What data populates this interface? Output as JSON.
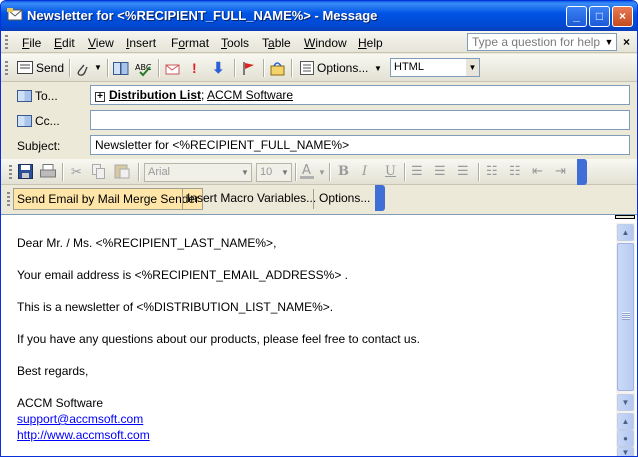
{
  "window": {
    "title": "Newsletter for <%RECIPIENT_FULL_NAME%> - Message",
    "controls": {
      "minimize": "_",
      "maximize": "□",
      "close": "×"
    }
  },
  "menu": {
    "items": [
      {
        "pre": "",
        "u": "F",
        "post": "ile"
      },
      {
        "pre": "",
        "u": "E",
        "post": "dit"
      },
      {
        "pre": "",
        "u": "V",
        "post": "iew"
      },
      {
        "pre": "",
        "u": "I",
        "post": "nsert"
      },
      {
        "pre": "F",
        "u": "o",
        "post": "rmat"
      },
      {
        "pre": "",
        "u": "T",
        "post": "ools"
      },
      {
        "pre": "T",
        "u": "a",
        "post": "ble"
      },
      {
        "pre": "",
        "u": "W",
        "post": "indow"
      },
      {
        "pre": "",
        "u": "H",
        "post": "elp"
      }
    ],
    "ask_placeholder": "Type a question for help",
    "close_glyph": "×"
  },
  "standard_toolbar": {
    "send_label": "Send",
    "options_label": "Options...",
    "format_value": "HTML"
  },
  "header": {
    "to_label": "To...",
    "cc_label": "Cc...",
    "subject_label": "Subject:",
    "to_plus": "+",
    "to_distribution": "Distribution List",
    "to_separator": ";",
    "to_recipient": "ACCM Software",
    "cc_value": "",
    "subject_value": "Newsletter for <%RECIPIENT_FULL_NAME%>"
  },
  "format_toolbar": {
    "font": "Arial",
    "size": "10",
    "bold": "B",
    "italic": "I",
    "underline": "U"
  },
  "mail_merge_toolbar": {
    "send_label": "Send Email by Mail Merge Sender",
    "macro_label": "Insert Macro Variables...",
    "options_label": "Options..."
  },
  "message": {
    "greeting": "Dear Mr. / Ms. <%RECIPIENT_LAST_NAME%>,",
    "email_line": "Your email address is <%RECIPIENT_EMAIL_ADDRESS%> .",
    "newsletter_line": "This is a newsletter of <%DISTRIBUTION_LIST_NAME%>.",
    "questions_line": "If you have any questions about our products, please feel free to contact us.",
    "regards": "Best regards,",
    "company": "ACCM Software",
    "email_link": "support@accmsoft.com",
    "web_link": "http://www.accmsoft.com"
  },
  "colors": {
    "title_bar": "#0055e5",
    "toolbar_accent": "#3f6fd6",
    "link": "#0000ff"
  }
}
